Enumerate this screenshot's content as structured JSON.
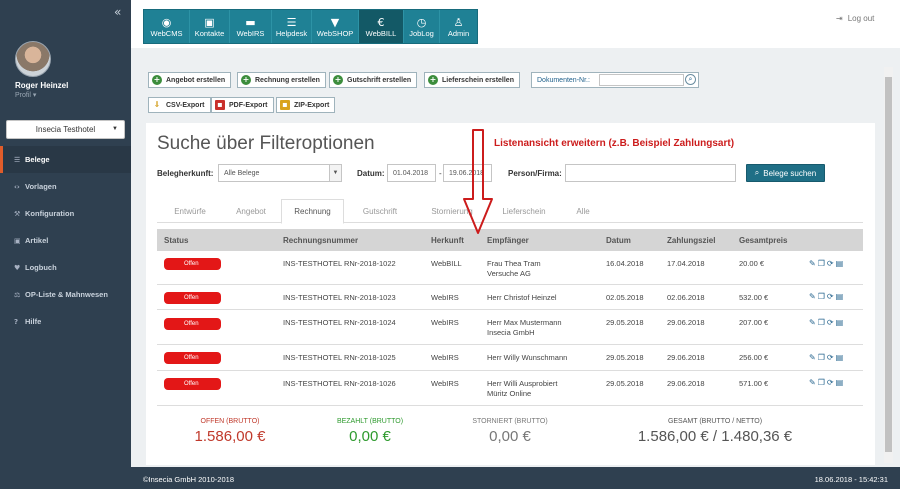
{
  "sidebar": {
    "collapse_icon": "double-chevron-left-icon",
    "user_name": "Roger Heinzel",
    "profile_label": "Profil ▾",
    "hotel_select": "Insecia Testhotel",
    "items": [
      {
        "label": "Belege",
        "icon": "list-icon",
        "active": true
      },
      {
        "label": "Vorlagen",
        "icon": "code-icon",
        "active": false
      },
      {
        "label": "Konfiguration",
        "icon": "wrench-icon",
        "active": false
      },
      {
        "label": "Artikel",
        "icon": "box-icon",
        "active": false
      },
      {
        "label": "Logbuch",
        "icon": "heart-icon",
        "active": false
      },
      {
        "label": "OP-Liste & Mahnwesen",
        "icon": "gavel-icon",
        "active": false
      },
      {
        "label": "Hilfe",
        "icon": "question-icon",
        "active": false
      }
    ]
  },
  "modules": [
    {
      "label": "WebCMS",
      "icon": "globe-icon",
      "glyph": "◉"
    },
    {
      "label": "Kontakte",
      "icon": "address-card-icon",
      "glyph": "▣"
    },
    {
      "label": "WebIRS",
      "icon": "bed-icon",
      "glyph": "▬"
    },
    {
      "label": "Helpdesk",
      "icon": "list-icon",
      "glyph": "☰"
    },
    {
      "label": "WebSHOP",
      "icon": "cart-icon",
      "glyph": "▼"
    },
    {
      "label": "WebBILL",
      "icon": "euro-icon",
      "glyph": "€"
    },
    {
      "label": "JobLog",
      "icon": "clock-icon",
      "glyph": "◷"
    },
    {
      "label": "Admin",
      "icon": "user-icon",
      "glyph": "♙"
    }
  ],
  "active_module": "WebBILL",
  "logout": "Log out",
  "toolbar": {
    "create_invoice_offer": "Angebot erstellen",
    "create_invoice": "Rechnung erstellen",
    "create_credit": "Gutschrift erstellen",
    "create_delivery": "Lieferschein erstellen",
    "doc_nr_label": "Dokumenten-Nr.:",
    "csv_export": "CSV-Export",
    "pdf_export": "PDF-Export",
    "zip_export": "ZIP-Export"
  },
  "search": {
    "title": "Suche über Filteroptionen",
    "annotation": "Listenansicht erweitern (z.B. Beispiel Zahlungsart)",
    "origin_label": "Belegherkunft:",
    "origin_value": "Alle Belege",
    "date_label": "Datum:",
    "date_from": "01.04.2018",
    "date_sep": "-",
    "date_to": "19.06.2018",
    "person_label": "Person/Firma:",
    "person_value": "",
    "search_button": "Belege suchen"
  },
  "tabs": [
    "Entwürfe",
    "Angebot",
    "Rechnung",
    "Gutschrift",
    "Stornierung",
    "Lieferschein",
    "Alle"
  ],
  "active_tab": "Rechnung",
  "table": {
    "headers": [
      "Status",
      "Rechnungsnummer",
      "Herkunft",
      "Empfänger",
      "Datum",
      "Zahlungsziel",
      "Gesamtpreis"
    ],
    "rows": [
      {
        "status": "Offen",
        "number": "INS-TESTHOTEL RNr-2018-1022",
        "origin": "WebBILL",
        "recipient": "Frau Thea Tram",
        "recipient2": "Versuche AG",
        "date": "16.04.2018",
        "due": "17.04.2018",
        "total": "20.00 €"
      },
      {
        "status": "Offen",
        "number": "INS-TESTHOTEL RNr-2018-1023",
        "origin": "WebIRS",
        "recipient": "Herr Christof Heinzel",
        "recipient2": "",
        "date": "02.05.2018",
        "due": "02.06.2018",
        "total": "532.00 €"
      },
      {
        "status": "Offen",
        "number": "INS-TESTHOTEL RNr-2018-1024",
        "origin": "WebIRS",
        "recipient": "Herr Max Mustermann",
        "recipient2": "Insecia GmbH",
        "date": "29.05.2018",
        "due": "29.06.2018",
        "total": "207.00 €"
      },
      {
        "status": "Offen",
        "number": "INS-TESTHOTEL RNr-2018-1025",
        "origin": "WebIRS",
        "recipient": "Herr Willy Wunschmann",
        "recipient2": "",
        "date": "29.05.2018",
        "due": "29.06.2018",
        "total": "256.00 €"
      },
      {
        "status": "Offen",
        "number": "INS-TESTHOTEL RNr-2018-1026",
        "origin": "WebIRS",
        "recipient": "Herr Willi Ausprobiert",
        "recipient2": "Müritz Online",
        "date": "29.05.2018",
        "due": "29.06.2018",
        "total": "571.00 €"
      }
    ],
    "row_actions": [
      "edit-icon",
      "copy-icon",
      "refresh-icon",
      "trash-icon"
    ]
  },
  "summary": {
    "open_label": "OFFEN (BRUTTO)",
    "open_value": "1.586,00 €",
    "paid_label": "BEZAHLT (BRUTTO)",
    "paid_value": "0,00 €",
    "cancelled_label": "STORNIERT (BRUTTO)",
    "cancelled_value": "0,00 €",
    "total_label": "GESAMT (BRUTTO / NETTO)",
    "total_value": "1.586,00 € / 1.480,36 €"
  },
  "colors": {
    "sidebar": "#2f4050",
    "module_bar": "#1f8195",
    "status_open": "#e31717",
    "open_value": "#c0392b",
    "paid_value": "#2e9a2e",
    "annotation": "#cc1c1c"
  },
  "footer": {
    "copyright": "©Insecia GmbH 2010-2018",
    "datetime": "18.06.2018 - 15:42:31"
  }
}
